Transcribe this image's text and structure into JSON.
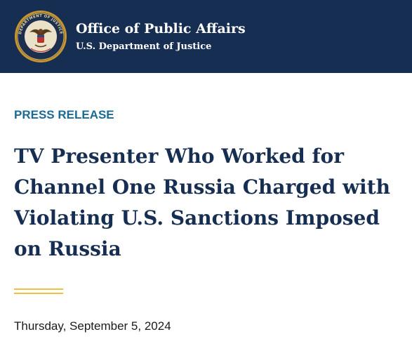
{
  "header": {
    "seal_icon": "doj-seal-icon",
    "seal_text": "DEPARTMENT OF JUSTICE",
    "office_title": "Office of Public Affairs",
    "dept_name": "U.S. Department of Justice"
  },
  "article": {
    "category": "PRESS RELEASE",
    "headline": "TV Presenter Who Worked for Channel One Russia Charged with Violating U.S. Sanctions Imposed on Russia",
    "date": "Thursday, September 5, 2024"
  },
  "colors": {
    "header_bg": "#162e51",
    "category": "#1a6a94",
    "headline": "#162e51",
    "accent": "#f2bd43"
  }
}
